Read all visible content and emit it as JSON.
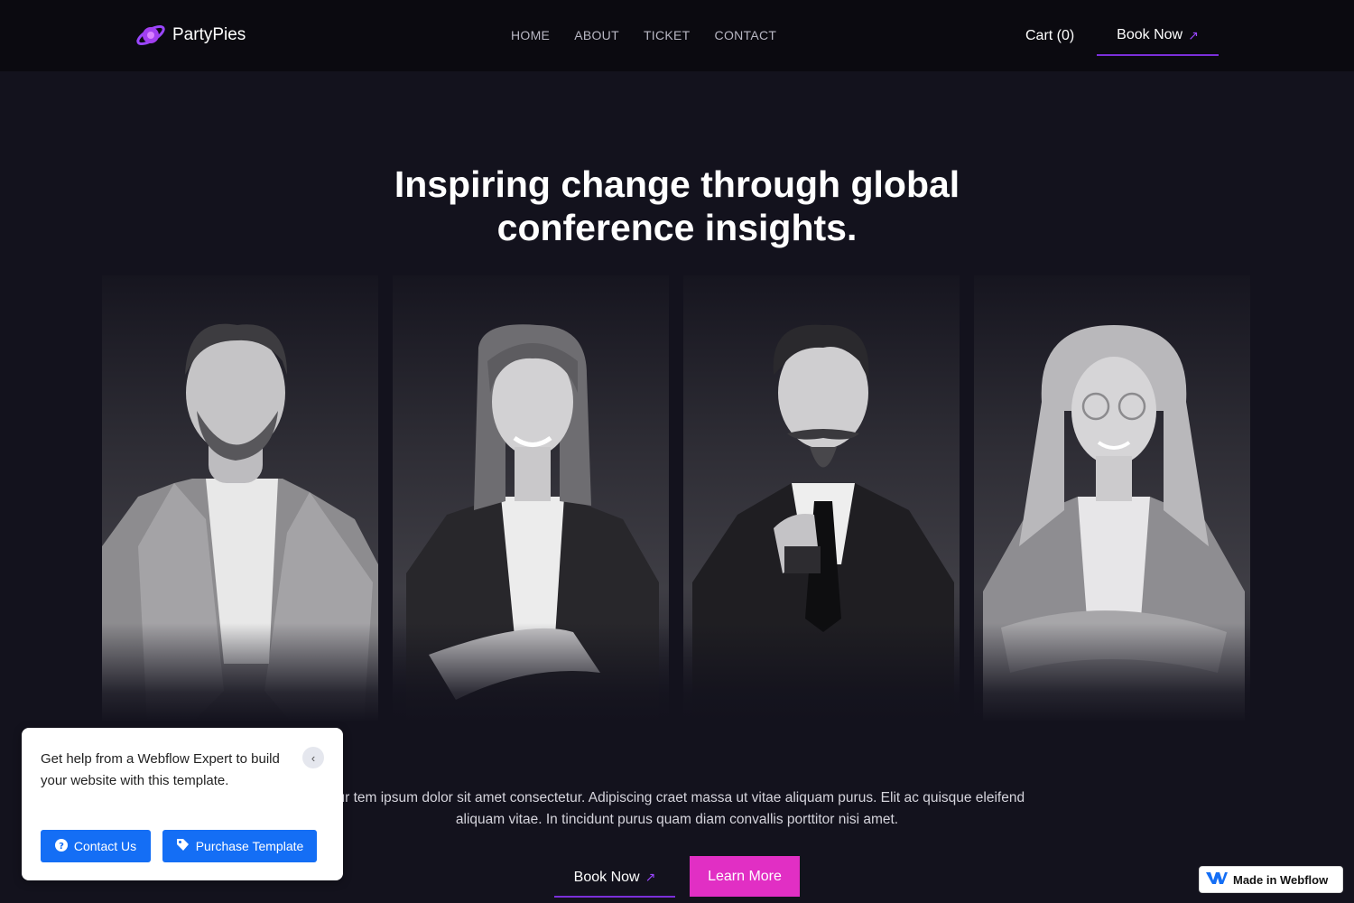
{
  "brand": {
    "name": "PartyPies",
    "accent": "#9a46ff",
    "pink": "#e12fc4"
  },
  "nav": {
    "menu": [
      {
        "label": "HOME"
      },
      {
        "label": "ABOUT"
      },
      {
        "label": "TICKET"
      },
      {
        "label": "CONTACT"
      }
    ],
    "cart_label": "Cart (0)",
    "book_label": "Book Now"
  },
  "hero": {
    "title_line1": "Inspiring change through global",
    "title_line2": "conference insights.",
    "description_line1": "our tem ipsum dolor sit amet consectetur. Adipiscing craet massa ut vitae aliquam purus. Elit ac quisque eleifend",
    "description_line2": "aliquam vitae. In tincidunt purus quam diam convallis porttitor nisi amet.",
    "book_label": "Book Now",
    "learn_label": "Learn More"
  },
  "speakers": [
    {
      "icon": "speaker-photo-man-blazer"
    },
    {
      "icon": "speaker-photo-woman-blazer"
    },
    {
      "icon": "speaker-photo-man-mustache"
    },
    {
      "icon": "speaker-photo-woman-glasses"
    }
  ],
  "help_popup": {
    "text": "Get help from a Webflow Expert to build your website with this template.",
    "contact_label": "Contact Us",
    "purchase_label": "Purchase Template"
  },
  "badge": {
    "label": "Made in Webflow"
  }
}
